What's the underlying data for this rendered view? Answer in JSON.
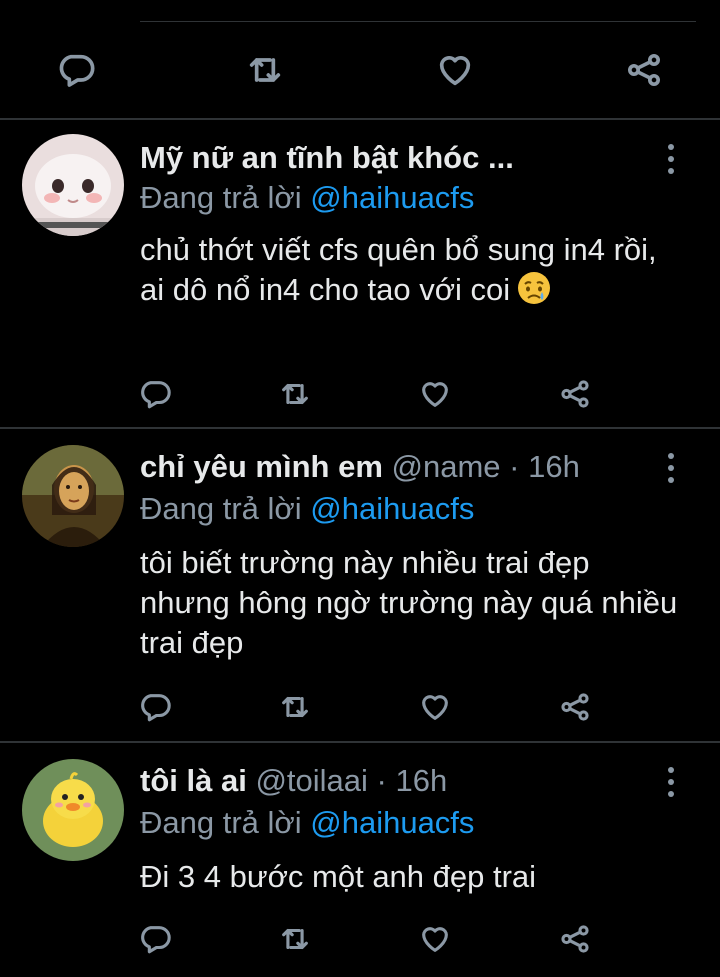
{
  "top_actions": {
    "icons": [
      "reply-icon",
      "retweet-icon",
      "like-icon",
      "share-icon"
    ]
  },
  "replies": [
    {
      "display_name": "Mỹ nữ an tĩnh bật khóc ...",
      "handle": "",
      "time": "",
      "replying_prefix": "Đang trả lời",
      "replying_to": "@haihuacfs",
      "text": "chủ thớt viết cfs quên bổ sung in4 rồi, ai dô nổ in4 cho tao với coi",
      "emoji": "crying-face-emoji"
    },
    {
      "display_name": "chỉ yêu mình em",
      "handle": "@name",
      "dot": "·",
      "time": "16h",
      "replying_prefix": "Đang trả lời",
      "replying_to": "@haihuacfs",
      "text": "tôi biết trường này nhiều trai đẹp nhưng hông ngờ trường này quá nhiều trai đẹp"
    },
    {
      "display_name": "tôi là ai",
      "handle": "@toilaai",
      "dot": "·",
      "time": "16h",
      "replying_prefix": "Đang trả lời",
      "replying_to": "@haihuacfs",
      "text": "Đi 3 4 bước một anh đẹp trai"
    }
  ],
  "colors": {
    "background": "#000000",
    "text": "#e7e9ea",
    "secondary": "#8b98a5",
    "accent": "#1d9bf0",
    "divider": "#2f3336"
  }
}
